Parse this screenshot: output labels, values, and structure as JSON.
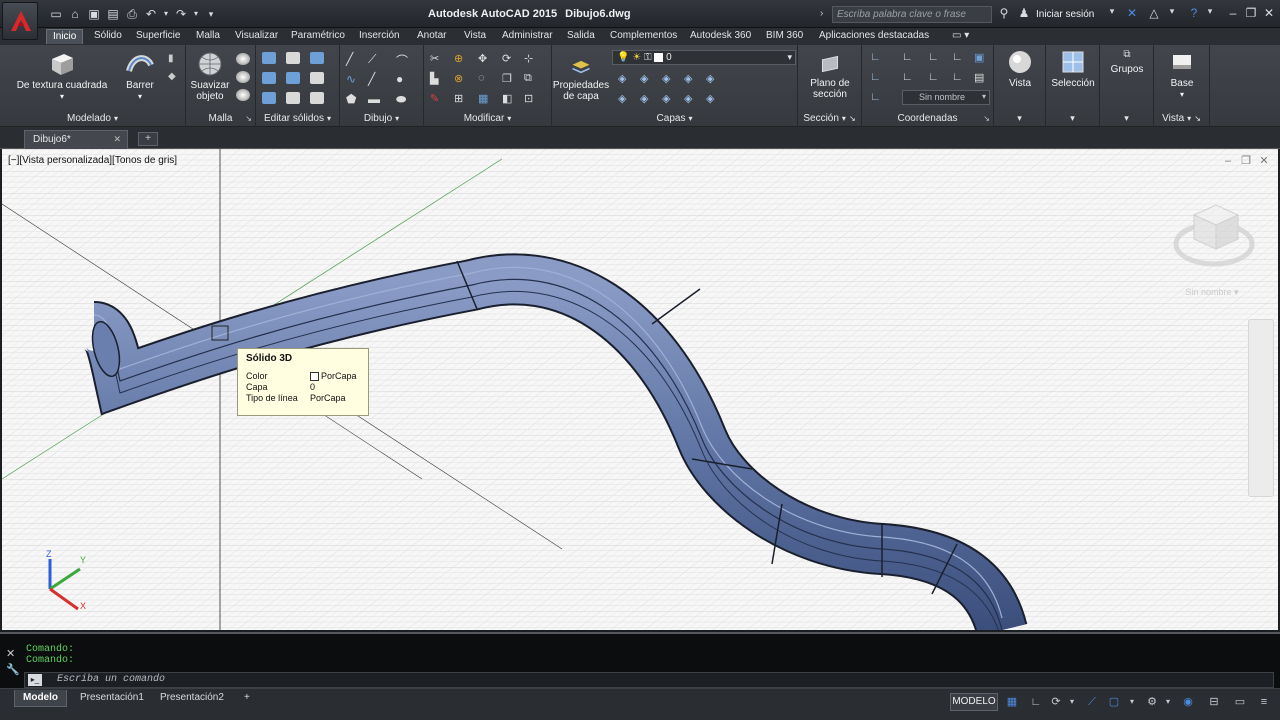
{
  "titlebar": {
    "app_name": "Autodesk AutoCAD 2015",
    "file_name": "Dibujo6.dwg",
    "search_placeholder": "Escriba palabra clave o frase",
    "signin_label": "Iniciar sesión"
  },
  "ribbon_tabs": [
    "Inicio",
    "Sólido",
    "Superficie",
    "Malla",
    "Visualizar",
    "Paramétrico",
    "Inserción",
    "Anotar",
    "Vista",
    "Administrar",
    "Salida",
    "Complementos",
    "Autodesk 360",
    "BIM 360",
    "Aplicaciones destacadas"
  ],
  "ribbon": {
    "modelado": {
      "label": "Modelado",
      "box_label": "De textura cuadrada",
      "sweep_label": "Barrer"
    },
    "malla": {
      "label": "Malla",
      "smooth_label": "Suavizar objeto"
    },
    "editar_solidos": {
      "label": "Editar sólidos"
    },
    "dibujo": {
      "label": "Dibujo"
    },
    "modificar": {
      "label": "Modificar"
    },
    "capas": {
      "label": "Capas",
      "props_label": "Propiedades de capa",
      "current_layer": "0"
    },
    "seccion": {
      "label": "Sección",
      "plane_label": "Plano de sección"
    },
    "coordenadas": {
      "label": "Coordenadas",
      "ucs_value": "Sin nombre"
    },
    "vista_btn": {
      "label": "Vista"
    },
    "seleccion": {
      "label": "Selección"
    },
    "grupos": {
      "label": "Grupos"
    },
    "base": {
      "label": "Base"
    },
    "vista_panel": {
      "label": "Vista"
    }
  },
  "file_tabs": {
    "active": "Dibujo6*"
  },
  "viewport": {
    "label": "[−][Vista personalizada][Tonos de gris]",
    "viewcube_label": "Sin nombre",
    "ucs_labels": {
      "z": "Z",
      "y": "Y",
      "x": "X"
    }
  },
  "tooltip": {
    "title": "Sólido 3D",
    "rows": [
      {
        "key": "Color",
        "value": "PorCapa"
      },
      {
        "key": "Capa",
        "value": "0"
      },
      {
        "key": "Tipo de línea",
        "value": "PorCapa"
      }
    ]
  },
  "command": {
    "history": [
      "Comando:",
      "Comando:"
    ],
    "placeholder": "Escriba un comando"
  },
  "status": {
    "layout_tabs": [
      "Modelo",
      "Presentación1",
      "Presentación2"
    ],
    "model_button": "MODELO"
  },
  "colors": {
    "tube": "#5b6f9e",
    "tube_light": "#7d90bd",
    "tube_dark": "#33456e",
    "grid": "#c6c6c6",
    "cmd_green": "#5fd35f"
  }
}
